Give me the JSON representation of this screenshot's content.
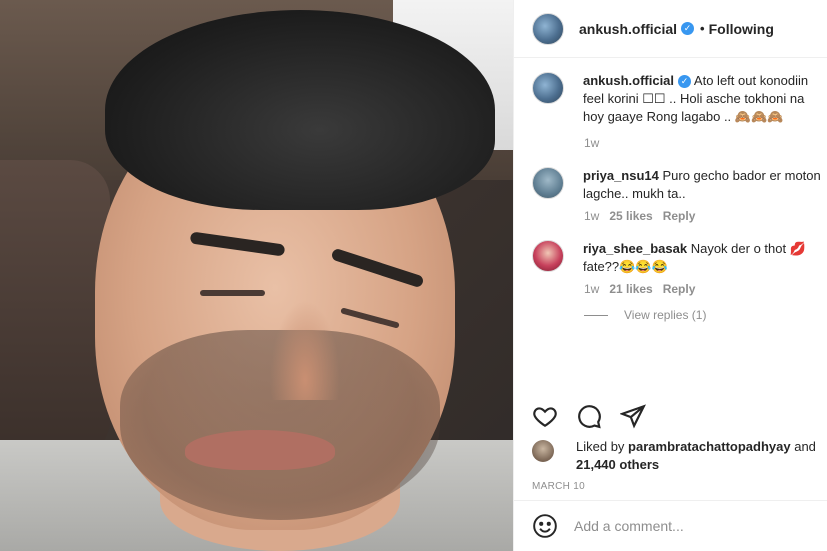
{
  "post": {
    "username": "ankush.official",
    "verified_icon": "verified-icon",
    "dot": "•",
    "follow_status": "Following"
  },
  "caption": {
    "username": "ankush.official",
    "text": " Ato left out konodiin feel korini ☐☐ .. Holi asche tokhoni na hoy gaaye Rong lagabo .. 🙈🙈🙈",
    "time": "1w"
  },
  "comments": [
    {
      "username": "priya_nsu14",
      "text": " Puro gecho bador er moton lagche.. mukh ta..",
      "time": "1w",
      "likes": "25 likes",
      "reply": "Reply"
    },
    {
      "username": "riya_shee_basak",
      "text": " Nayok der o thot 💋 fate??😂😂😂",
      "time": "1w",
      "likes": "21 likes",
      "reply": "Reply",
      "view_replies": "View replies (1)"
    }
  ],
  "likes_line": {
    "prefix": "Liked by ",
    "liker": "parambratachattopadhyay",
    "suffix": " and",
    "others": "21,440 others"
  },
  "date": "MARCH 10",
  "comment_box": {
    "placeholder": "Add a comment..."
  },
  "icons": {
    "like": "heart-icon",
    "comment": "comment-icon",
    "share": "share-icon",
    "emoji": "emoji-icon"
  }
}
